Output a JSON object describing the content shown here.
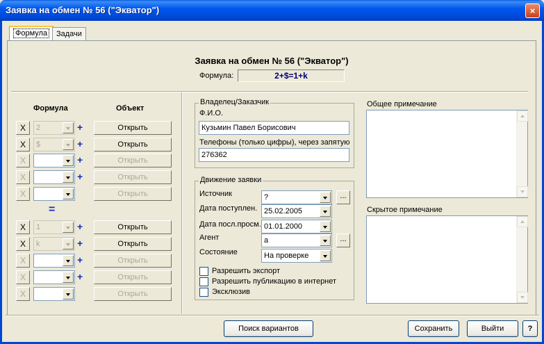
{
  "window": {
    "title": "Заявка на обмен № 56 (\"Экватор\")",
    "close": "×"
  },
  "tabs": [
    {
      "label": "Формула",
      "active": true
    },
    {
      "label": "Задачи",
      "active": false
    }
  ],
  "header": {
    "title": "Заявка на обмен № 56 (\"Экватор\")",
    "formula_label": "Формула:",
    "formula_value": "2+$=1+k"
  },
  "left": {
    "formula_header": "Формула",
    "object_header": "Объект",
    "equals": "=",
    "x_label": "X",
    "plus": "+",
    "top_rows": [
      {
        "value": "2",
        "enabled": true,
        "plus": true,
        "open": "Открыть"
      },
      {
        "value": "$",
        "enabled": true,
        "plus": true,
        "open": "Открыть"
      },
      {
        "value": "",
        "enabled": false,
        "plus": true,
        "open": "Открыть"
      },
      {
        "value": "",
        "enabled": false,
        "plus": true,
        "open": "Открыть"
      },
      {
        "value": "",
        "enabled": false,
        "plus": false,
        "open": "Открыть"
      }
    ],
    "bottom_rows": [
      {
        "value": "1",
        "enabled": true,
        "plus": true,
        "open": "Открыть"
      },
      {
        "value": "k",
        "enabled": true,
        "plus": true,
        "open": "Открыть"
      },
      {
        "value": "",
        "enabled": false,
        "plus": true,
        "open": "Открыть"
      },
      {
        "value": "",
        "enabled": false,
        "plus": true,
        "open": "Открыть"
      },
      {
        "value": "",
        "enabled": false,
        "plus": false,
        "open": "Открыть"
      }
    ]
  },
  "owner": {
    "legend": "Владелец/Заказчик",
    "fio_label": "Ф.И.О.",
    "fio_value": "Кузьмин Павел Борисович",
    "phones_label": "Телефоны (только цифры), через запятую",
    "phones_value": "276362"
  },
  "movement": {
    "legend": "Движение заявки",
    "source_label": "Источник",
    "source_value": "?",
    "received_label": "Дата поступлен.",
    "received_value": "25.02.2005",
    "lastview_label": "Дата посл.просм.",
    "lastview_value": "01.01.2000",
    "agent_label": "Агент",
    "agent_value": "a",
    "state_label": "Состояние",
    "state_value": "На проверке",
    "dots": "...",
    "allow_export": "Разрешить экспорт",
    "allow_publish": "Разрешить публикацию в интернет",
    "exclusive": "Эксклюзив"
  },
  "notes": {
    "general_label": "Общее примечание",
    "hidden_label": "Скрытое примечание"
  },
  "footer": {
    "search": "Поиск вариантов",
    "save": "Сохранить",
    "exit": "Выйти",
    "help": "?"
  }
}
